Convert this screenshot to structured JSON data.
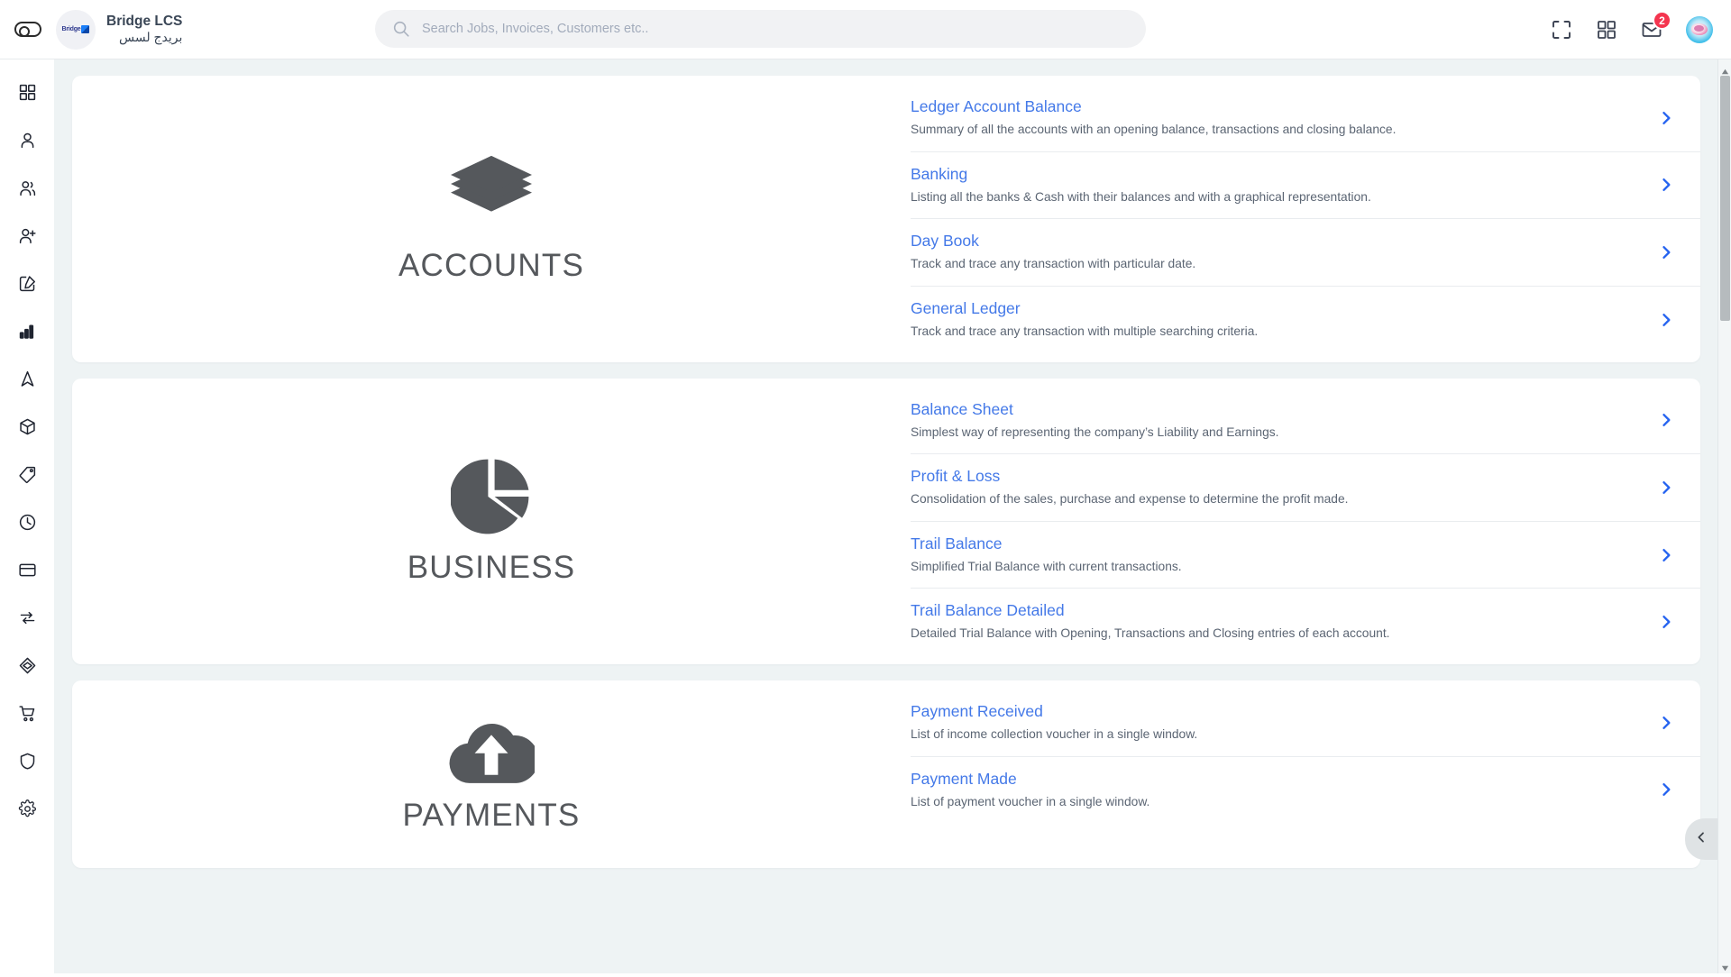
{
  "header": {
    "sidebar_toggle": "sidebar-toggle",
    "brand_name_en": "Bridge LCS",
    "brand_name_ar": "بريدج لسس",
    "brand_logo_text": "Bridge",
    "search": {
      "placeholder": "Search Jobs, Invoices, Customers etc..",
      "value": ""
    },
    "actions": {
      "fullscreen": "fullscreen-icon",
      "apps": "apps-grid-icon",
      "mail": "mail-icon",
      "mail_badge": "2",
      "avatar": "user-avatar"
    }
  },
  "sidebar": {
    "items": [
      {
        "icon": "dashboard-grid-icon",
        "name": "dashboard"
      },
      {
        "icon": "user-icon",
        "name": "customers"
      },
      {
        "icon": "users-icon",
        "name": "employees"
      },
      {
        "icon": "user-add-icon",
        "name": "add-user"
      },
      {
        "icon": "edit-square-icon",
        "name": "jobs"
      },
      {
        "icon": "bar-chart-icon",
        "name": "reports"
      },
      {
        "icon": "navigation-icon",
        "name": "tracking"
      },
      {
        "icon": "box-icon",
        "name": "inventory"
      },
      {
        "icon": "tag-icon",
        "name": "pricing"
      },
      {
        "icon": "clock-icon",
        "name": "timesheet"
      },
      {
        "icon": "card-icon",
        "name": "payments"
      },
      {
        "icon": "exchange-icon",
        "name": "transactions"
      },
      {
        "icon": "cube-3d-icon",
        "name": "packages"
      },
      {
        "icon": "cart-icon",
        "name": "purchases"
      },
      {
        "icon": "shield-icon",
        "name": "security"
      },
      {
        "icon": "gear-icon",
        "name": "settings"
      }
    ]
  },
  "main": {
    "sections": [
      {
        "title": "ACCOUNTS",
        "icon": "layers-icon",
        "rows": [
          {
            "title": "Ledger Account Balance",
            "desc": "Summary of all the accounts with an opening balance, transactions and closing balance."
          },
          {
            "title": "Banking",
            "desc": "Listing all the banks & Cash with their balances and with a graphical representation."
          },
          {
            "title": "Day Book",
            "desc": "Track and trace any transaction with particular date."
          },
          {
            "title": "General Ledger",
            "desc": "Track and trace any transaction with multiple searching criteria."
          }
        ]
      },
      {
        "title": "BUSINESS",
        "icon": "pie-chart-icon",
        "rows": [
          {
            "title": "Balance Sheet",
            "desc": "Simplest way of representing the company’s Liability and Earnings."
          },
          {
            "title": "Profit & Loss",
            "desc": "Consolidation of the sales, purchase and expense to determine the profit made."
          },
          {
            "title": "Trail Balance",
            "desc": "Simplified Trial Balance with current transactions."
          },
          {
            "title": "Trail Balance Detailed",
            "desc": "Detailed Trial Balance with Opening, Transactions and Closing entries of each account."
          }
        ]
      },
      {
        "title": "PAYMENTS",
        "icon": "cloud-upload-icon",
        "rows": [
          {
            "title": "Payment Received",
            "desc": "List of income collection voucher in a single window."
          },
          {
            "title": "Payment Made",
            "desc": "List of payment voucher in a single window."
          }
        ]
      }
    ]
  },
  "panel_tab": {
    "icon": "chevron-left-icon"
  },
  "colors": {
    "accent_link": "#4479e8",
    "badge_red": "#f4354f",
    "page_bg": "#eef3f4",
    "icon_gray": "#55585c"
  }
}
